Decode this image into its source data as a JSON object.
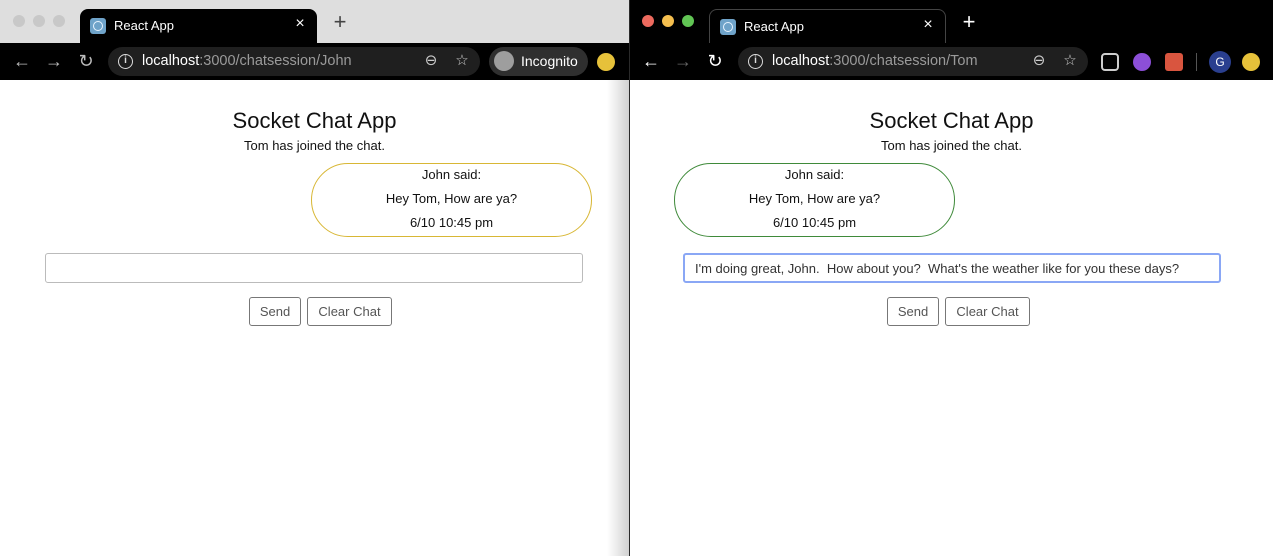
{
  "colors": {
    "traffic_close": "#ed6a5e",
    "traffic_min": "#f5bf4f",
    "traffic_max": "#61c554",
    "traffic_inactive": "#c8c8c8",
    "bubble_left_border": "#d8b735",
    "bubble_right_border": "#3f8a3a",
    "input_focus_border": "#8aa7f5"
  },
  "left_window": {
    "tab": {
      "title": "React App",
      "close": "×"
    },
    "newtab": "+",
    "toolbar": {
      "back": "←",
      "forward": "→",
      "reload": "↻",
      "url_host": "localhost",
      "url_path": ":3000/chatsession/John",
      "incognito_label": "Incognito"
    },
    "page": {
      "title": "Socket Chat App",
      "join_message": "Tom has joined the chat.",
      "message": {
        "author": "John said:",
        "text": "Hey Tom, How are ya?",
        "time": "6/10 10:45 pm"
      },
      "input_value": "",
      "send_label": "Send",
      "clear_label": "Clear Chat"
    }
  },
  "right_window": {
    "tab": {
      "title": "React App",
      "close": "×"
    },
    "newtab": "+",
    "toolbar": {
      "back": "←",
      "forward": "→",
      "reload": "↻",
      "url_host": "localhost",
      "url_path": ":3000/chatsession/Tom",
      "profile_initial": "G"
    },
    "page": {
      "title": "Socket Chat App",
      "join_message": "Tom has joined the chat.",
      "message": {
        "author": "John said:",
        "text": "Hey Tom, How are ya?",
        "time": "6/10 10:45 pm"
      },
      "input_value": "I'm doing great, John.  How about you?  What's the weather like for you these days?",
      "send_label": "Send",
      "clear_label": "Clear Chat"
    }
  }
}
